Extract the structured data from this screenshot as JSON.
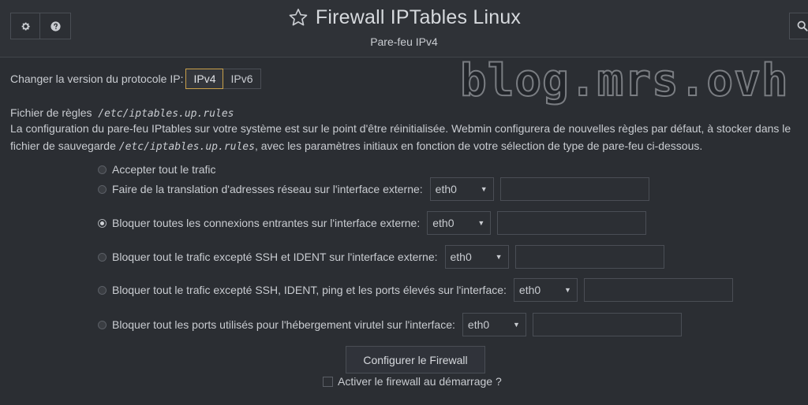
{
  "header": {
    "title": "Firewall IPTables Linux",
    "subtitle": "Pare-feu IPv4"
  },
  "icons": {
    "settings": "gear-icon",
    "help": "question-circle-icon",
    "favorite": "star-outline-icon",
    "search": "search-icon"
  },
  "watermark": "blog.mrs.ovh",
  "protocol": {
    "label": "Changer la version du protocole IP:",
    "options": [
      "IPv4",
      "IPv6"
    ],
    "selected": "IPv4"
  },
  "rules_file": {
    "label": "Fichier de règles",
    "path": "/etc/iptables.up.rules",
    "desc_part1": " La configuration du pare-feu IPtables sur votre système est sur le point d'être réinitialisée. Webmin configurera de nouvelles règles par défaut, à stocker dans le fichier de sauvegarde ",
    "desc_path": "/etc/iptables.up.rules",
    "desc_part2": ", avec les paramètres initiaux en fonction de votre sélection de type de pare-feu ci-dessous."
  },
  "options": [
    {
      "label": "Accepter tout le trafic",
      "checked": false
    },
    {
      "label": "Faire de la translation d'adresses réseau sur l'interface externe:",
      "checked": false,
      "interface": "eth0",
      "extra": ""
    },
    {
      "label": "Bloquer toutes les connexions entrantes sur l'interface externe:",
      "checked": true,
      "interface": "eth0",
      "extra": ""
    },
    {
      "label": "Bloquer tout le trafic excepté SSH et IDENT sur l'interface externe:",
      "checked": false,
      "interface": "eth0",
      "extra": ""
    },
    {
      "label": "Bloquer tout le trafic excepté SSH, IDENT, ping et les ports élevés sur l'interface:",
      "checked": false,
      "interface": "eth0",
      "extra": ""
    },
    {
      "label": "Bloquer tout les ports utilisés pour l'hébergement virutel sur l'interface:",
      "checked": false,
      "interface": "eth0",
      "extra": ""
    }
  ],
  "configure_button": "Configurer le Firewall",
  "activate_on_boot": {
    "label": "Activer le firewall au démarrage ?",
    "checked": false
  }
}
